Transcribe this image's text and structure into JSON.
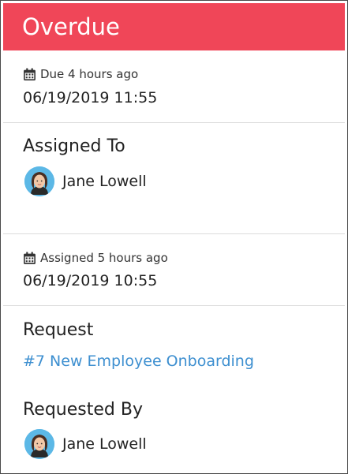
{
  "banner": {
    "status": "Overdue"
  },
  "due": {
    "relative": "Due 4 hours ago",
    "datetime": "06/19/2019 11:55",
    "icon": "calendar-icon"
  },
  "assigned_to": {
    "heading": "Assigned To",
    "name": "Jane Lowell",
    "icon": "avatar"
  },
  "assigned": {
    "relative": "Assigned 5 hours ago",
    "datetime": "06/19/2019 10:55",
    "icon": "calendar-icon"
  },
  "request": {
    "heading": "Request",
    "link": "#7 New Employee Onboarding"
  },
  "requested_by": {
    "heading": "Requested By",
    "name": "Jane Lowell",
    "icon": "avatar"
  },
  "colors": {
    "banner": "#f04658",
    "link": "#3d8fd0",
    "avatar_bg": "#5cb8e6"
  }
}
